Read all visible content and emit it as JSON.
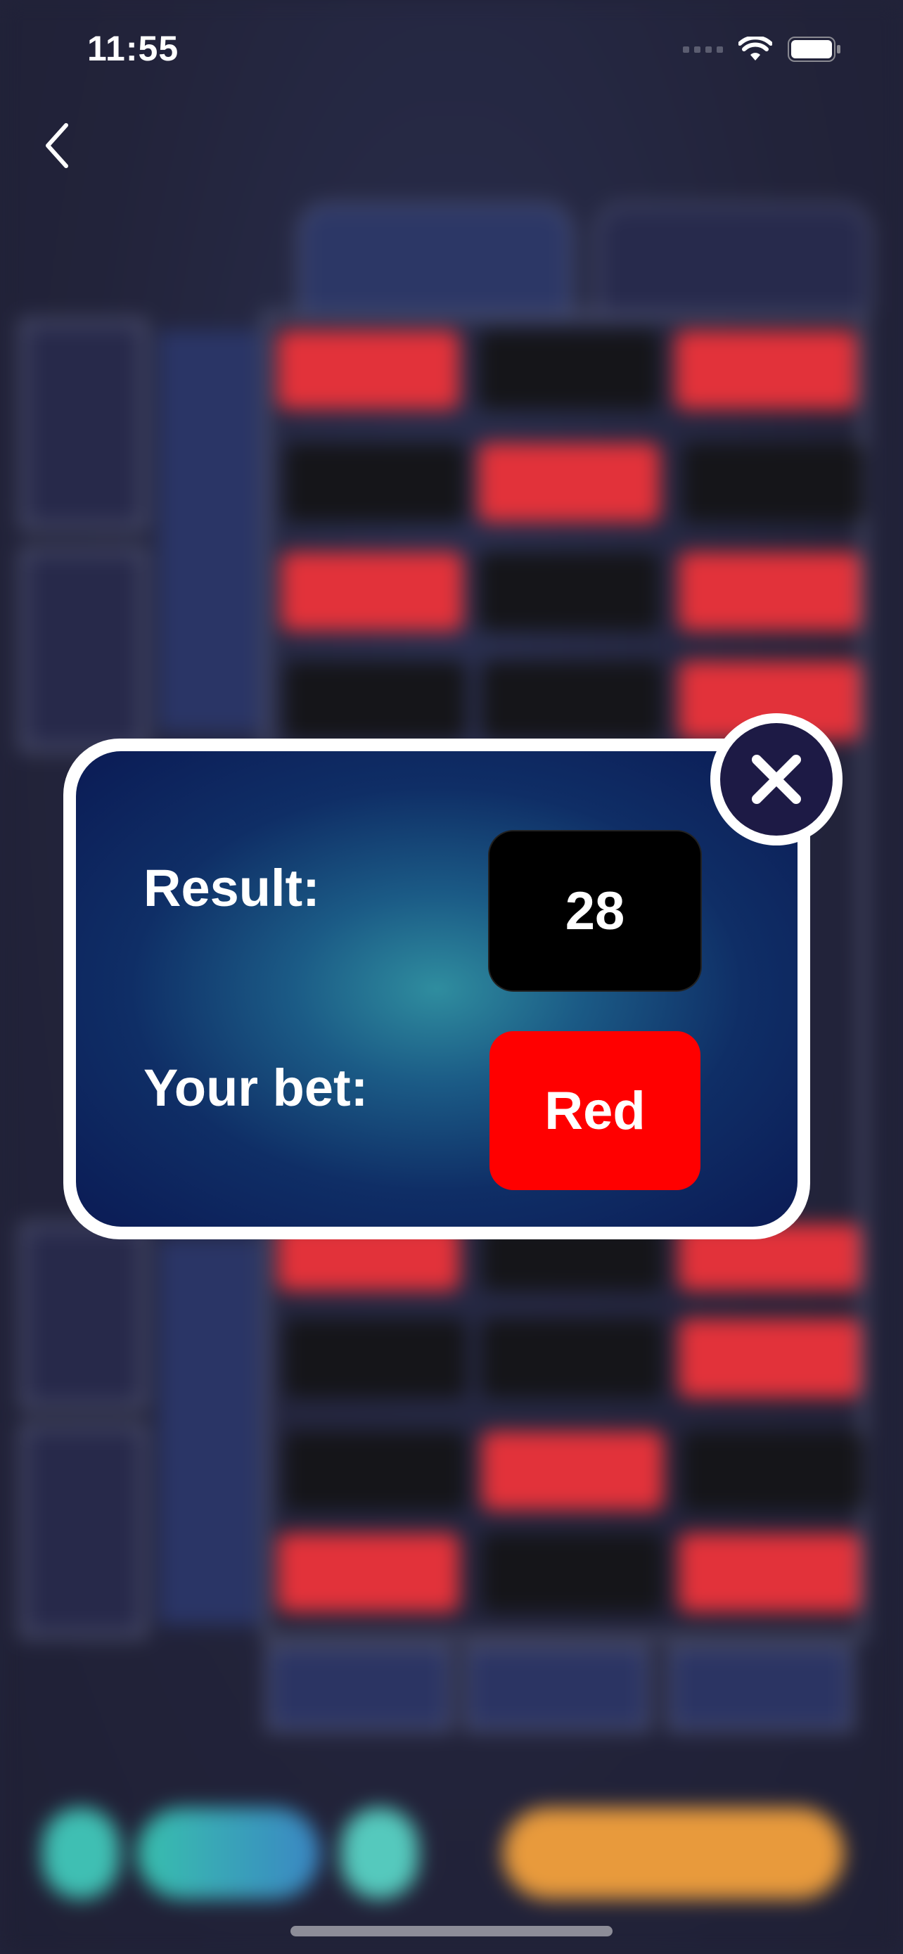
{
  "status_bar": {
    "time": "11:55"
  },
  "dialog": {
    "result_label": "Result:",
    "result_value": "28",
    "bet_label": "Your bet:",
    "bet_value": "Red"
  },
  "colors": {
    "bet_red": "#ff0000",
    "result_black": "#000000",
    "dialog_bg": "#0b1b55"
  },
  "icons": {
    "back": "chevron-left-icon",
    "close": "close-icon"
  }
}
